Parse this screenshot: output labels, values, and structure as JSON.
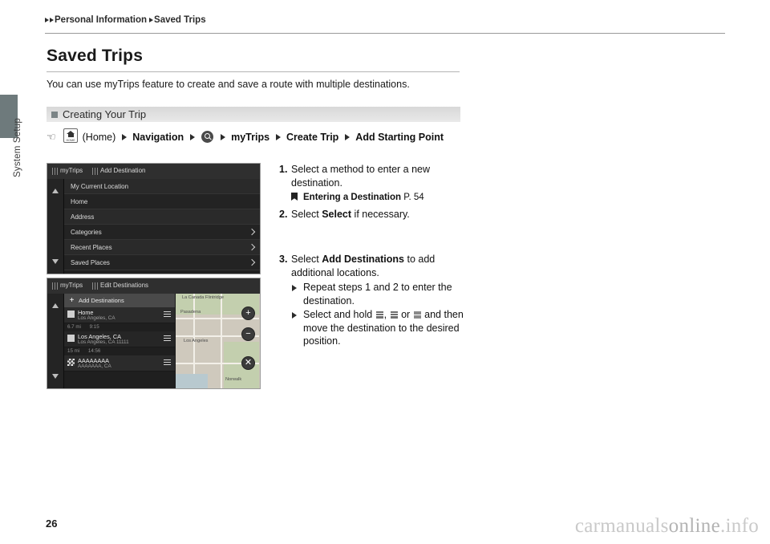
{
  "sidebar": {
    "tab_label": "System Setup"
  },
  "breadcrumb": {
    "items": [
      "Personal Information",
      "Saved Trips"
    ]
  },
  "page": {
    "title": "Saved Trips",
    "intro": "You can use myTrips feature to create and save a route with multiple destinations.",
    "page_number": "26"
  },
  "section": {
    "heading": "Creating Your Trip"
  },
  "navpath": {
    "home_label": "(Home)",
    "home_icon_word": "HOME",
    "items": [
      "Navigation",
      "myTrips",
      "Create Trip",
      "Add Starting Point"
    ]
  },
  "screenshot1": {
    "tab_left": "myTrips",
    "tab_right": "Add Destination",
    "rows": [
      {
        "label": "My Current Location",
        "chevron": false
      },
      {
        "label": "Home",
        "chevron": false
      },
      {
        "label": "Address",
        "chevron": false
      },
      {
        "label": "Categories",
        "chevron": true
      },
      {
        "label": "Recent Places",
        "chevron": true
      },
      {
        "label": "Saved Places",
        "chevron": true
      }
    ]
  },
  "screenshot2": {
    "tab_left": "myTrips",
    "tab_right": "Edit Destinations",
    "add_button": "Add Destinations",
    "destinations": [
      {
        "name": "Home",
        "sub": "Los Angeles, CA",
        "distance": "6.7 mi",
        "time": "9:15"
      },
      {
        "name": "Los Angeles, CA",
        "sub": "Los Angeles, CA 11111",
        "distance": "15 mi",
        "time": "14:56"
      },
      {
        "name": "AAAAAAAA",
        "sub": "AAAAAAA, CA",
        "distance": "",
        "time": ""
      }
    ],
    "map_labels": [
      "La Canada Flintridge",
      "Pasadena",
      "Los Angeles",
      "Norwalk"
    ],
    "map_buttons": [
      "+",
      "−",
      "✕"
    ]
  },
  "steps": [
    {
      "num": "1.",
      "text": "Select a method to enter a new destination.",
      "ref": "Entering a Destination",
      "ref_page": "P. 54"
    },
    {
      "num": "2.",
      "text_prefix": "Select ",
      "text_bold": "Select",
      "text_suffix": " if necessary."
    },
    {
      "num": "3.",
      "text_prefix": "Select ",
      "text_bold": "Add Destinations",
      "text_suffix": " to add additional locations.",
      "subs": [
        "Repeat steps 1 and 2 to enter the destination.",
        "Select and hold , or and then move the destination to the desired position."
      ]
    }
  ],
  "footer": {
    "watermark_a": "carmanuals",
    "watermark_b": "online",
    "watermark_c": ".info"
  }
}
